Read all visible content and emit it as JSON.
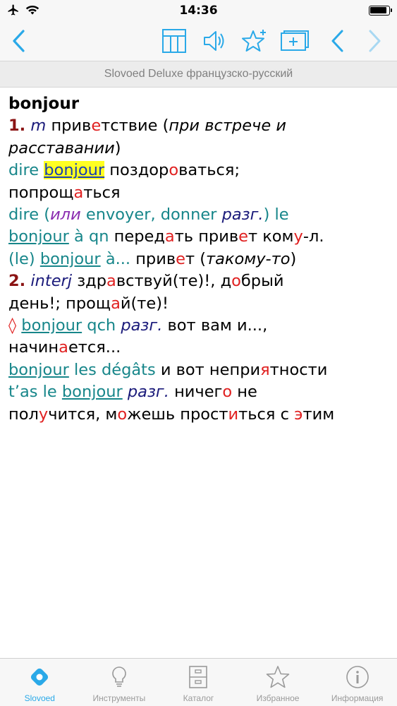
{
  "status_bar": {
    "time": "14:36"
  },
  "toolbar": {
    "icons": [
      "back-chevron-icon",
      "table-icon",
      "speaker-icon",
      "star-add-icon",
      "card-add-icon",
      "previous-chevron-icon",
      "next-chevron-icon"
    ],
    "accent_color": "#2aa9e8",
    "disabled_color": "#a8d8f2"
  },
  "subtitle": "Slovoed Deluxe французско-русский",
  "entry": {
    "headword": "bonjour",
    "sense1": {
      "num": "1.",
      "gram": "m",
      "trans_p1": "прив",
      "trans_s": "е",
      "trans_p2": "тствие (",
      "note": "при встрече и расставании",
      "close": ")",
      "ex1": {
        "fr_prefix": "dire",
        "fr_highlight": "bonjour",
        "ru1_a": "поздор",
        "ru1_s": "о",
        "ru1_b": "ваться;",
        "ru2_a": "попрощ",
        "ru2_s": "а",
        "ru2_b": "ться"
      },
      "ex2": {
        "fr_a": "dire (",
        "ili": "или",
        "fr_b": "envoyer, donner",
        "razg": "разг.",
        "fr_c": ") le",
        "fr_link": "bonjour",
        "fr_d": "à qn",
        "ru_a": "перед",
        "ru_s1": "а",
        "ru_b": "ть прив",
        "ru_s2": "е",
        "ru_c": "т ком",
        "ru_s3": "у",
        "ru_d": "-л."
      },
      "ex3": {
        "fr_a": "(le)",
        "fr_link": "bonjour",
        "fr_b": "à...",
        "ru_a": "прив",
        "ru_s": "е",
        "ru_b": "т (",
        "note": "такому-то",
        "close": ")"
      }
    },
    "sense2": {
      "num": "2.",
      "gram": "interj",
      "trans1_a": "здр",
      "trans1_s": "а",
      "trans1_b": "вствуй(те)!, д",
      "trans1_s2": "о",
      "trans1_c": "брый",
      "trans2_a": "день!; прощ",
      "trans2_s": "а",
      "trans2_b": "й(те)!"
    },
    "phrase1": {
      "diamond": "◊",
      "fr_link": "bonjour",
      "fr_b": "qch",
      "razg": "разг.",
      "ru1": "вот вам и...,",
      "ru2_a": "начин",
      "ru2_s": "а",
      "ru2_b": "ется..."
    },
    "phrase2": {
      "fr_link": "bonjour",
      "fr_b": "les dégâts",
      "ru_a": "и вот непри",
      "ru_s": "я",
      "ru_b": "тности"
    },
    "phrase3": {
      "fr_a": "t’as le",
      "fr_link": "bonjour",
      "razg": "разг.",
      "ru1_a": "ничег",
      "ru1_s": "о",
      "ru1_b": "не",
      "ru2_a": "пол",
      "ru2_s1": "у",
      "ru2_b": "чится, м",
      "ru2_s2": "о",
      "ru2_c": "жешь прост",
      "ru2_s3": "и",
      "ru2_d": "ться с",
      "ru2_s4": "э",
      "ru2_e": "тим"
    }
  },
  "tabbar": {
    "tabs": [
      {
        "label": "Slovoed",
        "icon": "slovoed-logo-icon",
        "active": true
      },
      {
        "label": "Инструменты",
        "icon": "lightbulb-icon",
        "active": false
      },
      {
        "label": "Каталог",
        "icon": "cabinet-icon",
        "active": false
      },
      {
        "label": "Избранное",
        "icon": "star-icon",
        "active": false
      },
      {
        "label": "Информация",
        "icon": "info-icon",
        "active": false
      }
    ]
  }
}
